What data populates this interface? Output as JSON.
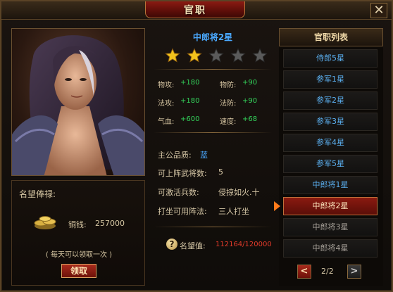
{
  "window": {
    "title": "官职",
    "close_label": "✕"
  },
  "salary": {
    "title": "名望俸禄:",
    "coin_label": "铜钱:",
    "coin_value": "257000",
    "daily_note": "( 每天可以领取一次 )",
    "receive_label": "领取"
  },
  "rank": {
    "name": "中郎将2星",
    "stars_total": 5,
    "stars_filled": 2,
    "colors": {
      "star_filled": "#f2c21c",
      "star_empty": "#5a5a5a"
    }
  },
  "stats": [
    {
      "label": "物攻:",
      "value": "+180"
    },
    {
      "label": "物防:",
      "value": "+90"
    },
    {
      "label": "法攻:",
      "value": "+180"
    },
    {
      "label": "法防:",
      "value": "+90"
    },
    {
      "label": "气血:",
      "value": "+600"
    },
    {
      "label": "速度:",
      "value": "+68"
    }
  ],
  "props": [
    {
      "label": "主公品质:",
      "value": "蓝"
    },
    {
      "label": "可上阵武将数:",
      "value": "5"
    },
    {
      "label": "可激活兵数:",
      "value": "侵掠如火.十"
    },
    {
      "label": "打坐可用阵法:",
      "value": "三人打坐"
    }
  ],
  "fame": {
    "icon": "question-mark-icon",
    "label": "名望值:",
    "value": "112164/120000"
  },
  "rank_list": {
    "title": "官职列表",
    "items": [
      {
        "label": "侍郎5星",
        "state": "unlocked"
      },
      {
        "label": "参军1星",
        "state": "unlocked"
      },
      {
        "label": "参军2星",
        "state": "unlocked"
      },
      {
        "label": "参军3星",
        "state": "unlocked"
      },
      {
        "label": "参军4星",
        "state": "unlocked"
      },
      {
        "label": "参军5星",
        "state": "unlocked"
      },
      {
        "label": "中郎将1星",
        "state": "unlocked"
      },
      {
        "label": "中郎将2星",
        "state": "selected"
      },
      {
        "label": "中郎将3星",
        "state": "locked"
      },
      {
        "label": "中郎将4星",
        "state": "locked"
      }
    ],
    "page_indicator": "2/2",
    "prev_label": "<",
    "next_label": ">"
  }
}
